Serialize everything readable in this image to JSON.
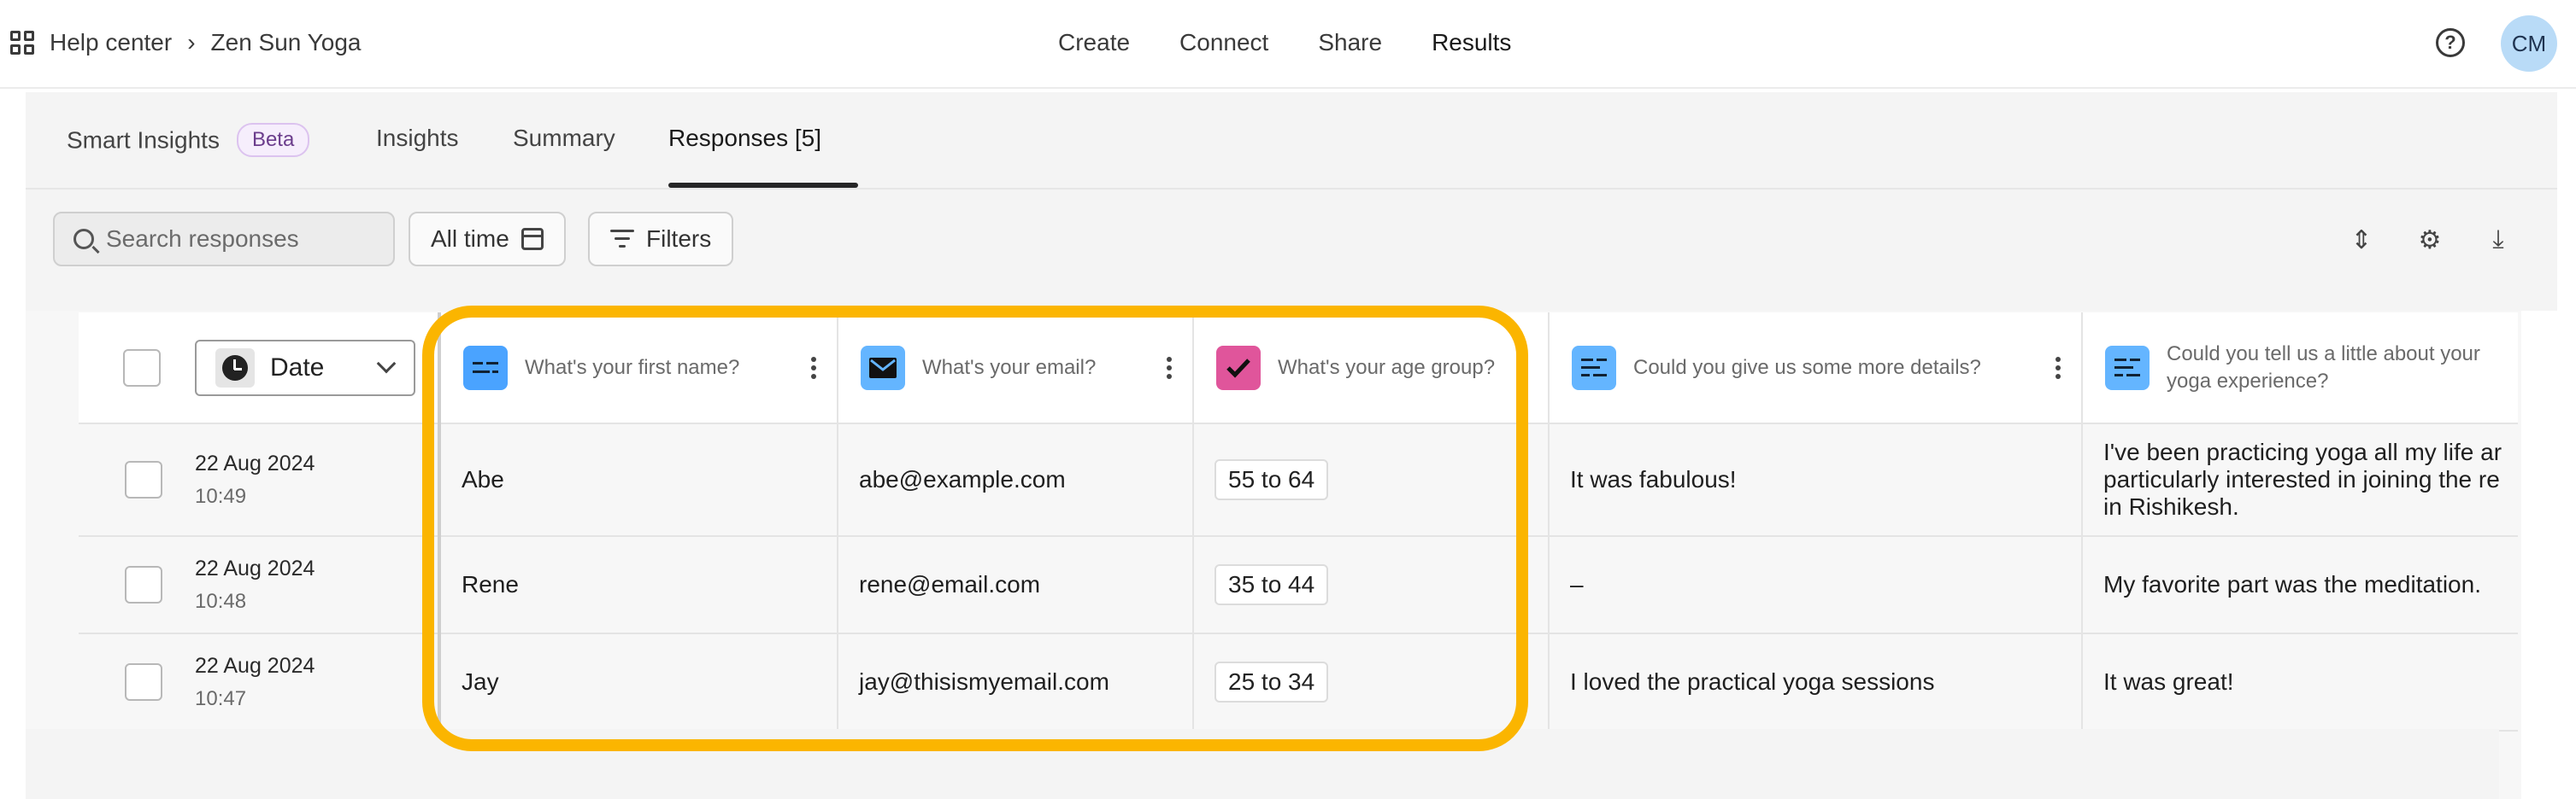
{
  "breadcrumb": {
    "home": "Help center",
    "current": "Zen Sun Yoga"
  },
  "topnav": [
    "Create",
    "Connect",
    "Share",
    "Results"
  ],
  "user": {
    "initials": "CM"
  },
  "tabs": {
    "smart_insights": "Smart Insights",
    "beta": "Beta",
    "insights": "Insights",
    "summary": "Summary",
    "responses": "Responses [5]"
  },
  "toolbar": {
    "search_placeholder": "Search responses",
    "time_filter": "All time",
    "filters": "Filters"
  },
  "table": {
    "date_column": "Date",
    "questions": [
      "What's your first name?",
      "What's your email?",
      "What's your age group?",
      "Could you give us some more details?",
      "Could you tell us a little about your yoga experience?"
    ],
    "rows": [
      {
        "date": "22 Aug 2024",
        "time": "10:49",
        "name": "Abe",
        "email": "abe@example.com",
        "age": "55 to 64",
        "details": "It was fabulous!",
        "exp1": "I've been practicing yoga all my life ar",
        "exp2": "particularly interested in joining the re",
        "exp3": "in Rishikesh."
      },
      {
        "date": "22 Aug 2024",
        "time": "10:48",
        "name": "Rene",
        "email": "rene@email.com",
        "age": "35 to 44",
        "details": "–",
        "exp1": "My favorite part was the meditation."
      },
      {
        "date": "22 Aug 2024",
        "time": "10:47",
        "name": "Jay",
        "email": "jay@thisismyemail.com",
        "age": "25 to 34",
        "details": "I loved the practical yoga sessions",
        "exp1": "It was great!"
      }
    ]
  },
  "colors": {
    "highlight": "#fbb500",
    "accent_blue": "#4aa3ff",
    "accent_pink": "#e0559b"
  }
}
